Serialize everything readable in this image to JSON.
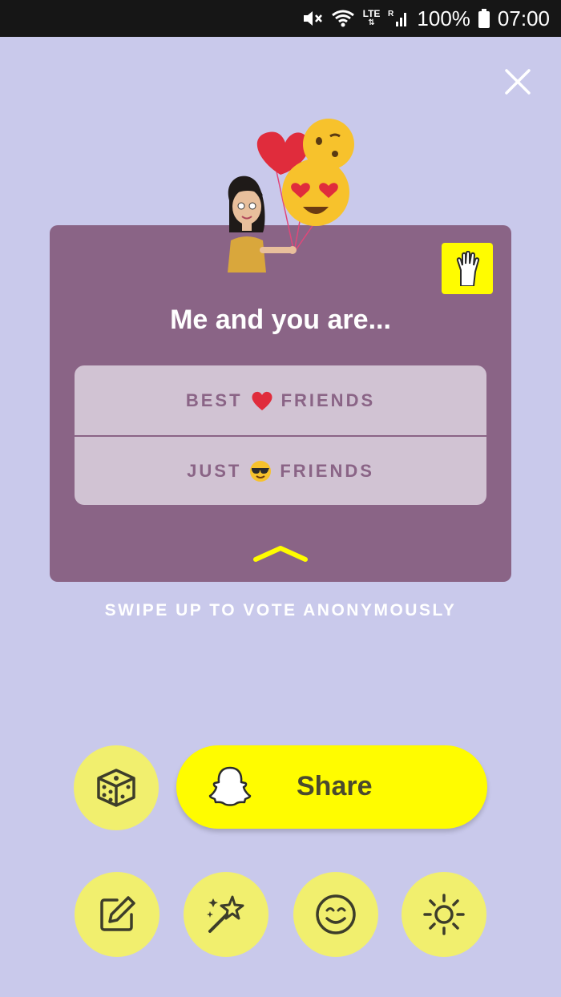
{
  "status_bar": {
    "network": "LTE",
    "roaming": "R",
    "battery": "100%",
    "time": "07:00"
  },
  "card": {
    "question": "Me and you are...",
    "options": [
      {
        "pre": "BEST",
        "emoji": "red-heart",
        "post": "FRIENDS"
      },
      {
        "pre": "JUST",
        "emoji": "sunglasses-face",
        "post": "FRIENDS"
      }
    ]
  },
  "swipe_hint": "SWIPE UP TO VOTE ANONYMOUSLY",
  "share": {
    "label": "Share"
  },
  "colors": {
    "background": "#c9c9eb",
    "card": "#8a6486",
    "options_bg": "#d1c3d3",
    "snap_yellow": "#fffc00",
    "tool_yellow": "#f1ef6e"
  },
  "icons": [
    "close-icon",
    "raise-hand-icon",
    "dice-icon",
    "snapchat-ghost-icon",
    "edit-icon",
    "magic-wand-icon",
    "smiley-icon",
    "brightness-icon"
  ]
}
